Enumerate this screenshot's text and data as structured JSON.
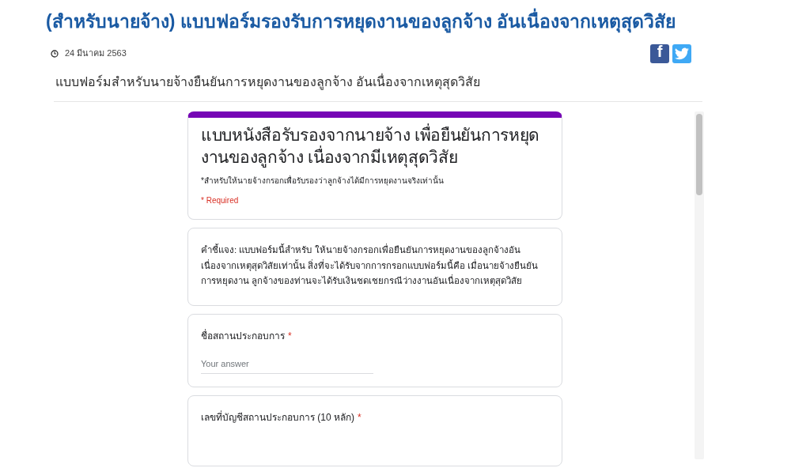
{
  "article": {
    "title": "(สำหรับนายจ้าง) แบบฟอร์มรองรับการหยุดงานของลูกจ้าง อันเนื่องจากเหตุสุดวิสัย",
    "date": "24 มีนาคม 2563",
    "share": [
      {
        "kind": "facebook",
        "label": "f"
      },
      {
        "kind": "twitter"
      }
    ],
    "subtitle": "แบบฟอร์มสำหรับนายจ้างยืนยันการหยุดงานของลูกจ้าง อันเนื่องจากเหตุสุดวิสัย"
  },
  "form": {
    "title": "แบบหนังสือรับรองจากนายจ้าง เพื่อยืนยันการหยุดงานของลูกจ้าง เนื่องจากมีเหตุสุดวิสัย",
    "description": "*สำหรับให้นายจ้างกรอกเพื่อรับรองว่าลูกจ้างได้มีการหยุดงานจริงเท่านั้น",
    "required_note": "* Required",
    "note": "คำชี้แจง: แบบฟอร์มนี้สำหรับ ให้นายจ้างกรอกเพื่อยืนยันการหยุดงานของลูกจ้างอันเนื่องจากเหตุสุดวิสัยเท่านั้น สิ่งที่จะได้รับจากการกรอกแบบฟอร์มนี้คือ เมื่อนายจ้างยืนยันการหยุดงาน ลูกจ้างของท่านจะได้รับเงินชดเชยกรณีว่างงานอันเนื่องจากเหตุสุดวิสัย",
    "questions": [
      {
        "label": "ชื่อสถานประกอบการ",
        "required_mark": "*",
        "placeholder": "Your answer"
      },
      {
        "label": "เลขที่บัญชีสถานประกอบการ (10 หลัก)",
        "required_mark": "*"
      }
    ]
  }
}
